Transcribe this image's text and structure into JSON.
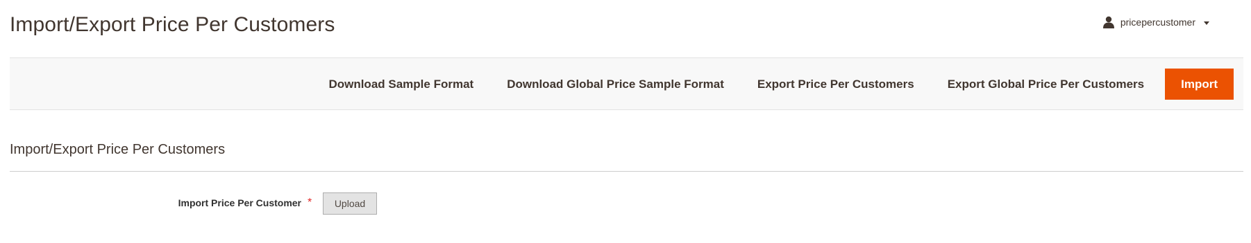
{
  "header": {
    "title": "Import/Export Price Per Customers",
    "user": {
      "username": "pricepercustomer",
      "icon": "user-icon",
      "menu_icon": "chevron-down-icon"
    }
  },
  "actions": {
    "download_sample": "Download Sample Format",
    "download_global_sample": "Download Global Price Sample Format",
    "export_price": "Export Price Per Customers",
    "export_global_price": "Export Global Price Per Customers",
    "import": "Import"
  },
  "section": {
    "title": "Import/Export Price Per Customers"
  },
  "form": {
    "import_field": {
      "label": "Import Price Per Customer",
      "required_mark": "*",
      "button_label": "Upload"
    }
  },
  "colors": {
    "primary": "#eb5202",
    "text": "#41362f",
    "required": "#e22626",
    "bar_background": "#f8f8f8"
  }
}
